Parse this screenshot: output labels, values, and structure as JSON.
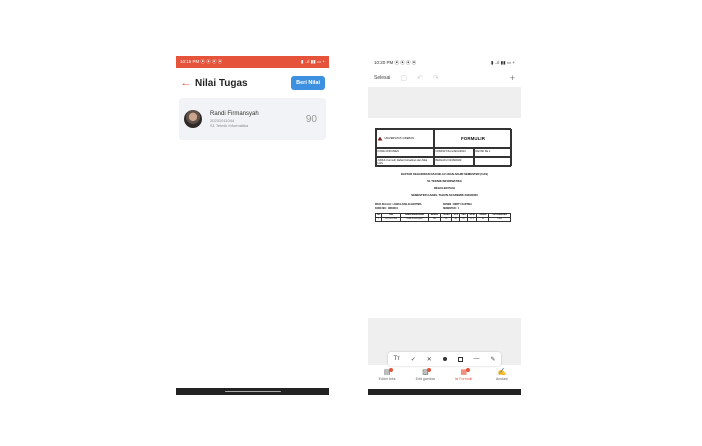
{
  "left_phone": {
    "status": {
      "time": "10:15 PM",
      "icons_left": "⦿ ⦿ ⦿ ⦿",
      "icons_right": "▮ ..ıl ▮▮ ▭ +"
    },
    "header": {
      "back_icon": "←",
      "title": "Nilai Tugas",
      "beri_nilai_label": "Beri Nilai"
    },
    "student": {
      "name": "Randi Firmansyah",
      "nim": "20231011044",
      "prodi": "S1 Teknik Informatika",
      "score": "90"
    }
  },
  "right_phone": {
    "status": {
      "time": "10:20 PM",
      "icons_left": "⦿ ⦿ ⦿ ⦿",
      "icons_right": "▮ ..ıl ▮▮ ▭ +"
    },
    "toolbar": {
      "done_label": "Selesai",
      "plus_icon": "+"
    },
    "document": {
      "logo_text": "UNIVERSITAS CIREBON",
      "formulir": "FORMULIR",
      "kode_label": "KODE DOKUMEN",
      "kode_value": "",
      "nomor_label": "NOMOR",
      "nomor_value": "FKom/AKA/2023",
      "revisi_label": "REVISI KE",
      "revisi_value": "1",
      "judul_label": "JUDUL",
      "judul_value": "Formulir Daftar Kehadiran dan Nilai UAS",
      "berlaku_label": "BERLAKU",
      "berlaku_value": "01/09/2023",
      "caption1": "DAFTAR KEHADIRAN DAN NILAI UJIAN AKHIR SEMESTER (UAS)",
      "caption2": "S1 TEKNIK INFORMATIKA",
      "caption3": "REGULER PAGI",
      "caption4": "SEMESTER GANJIL TAHUN AKADEMIK 2023/2023",
      "meta_matkul": "MATA KULIAH   : LOGIKA DAN ALGORITMA",
      "meta_dosen": "DOSEN : BERTY KARTIKA",
      "meta_kode": "KODE MK  : 1MK0001",
      "meta_semester": "SEMESTER : 1",
      "table_headers": [
        "NO",
        "NIM",
        "NAMA MAHASISWA",
        "ABSEN",
        "TUGAS",
        "UTS",
        "UAS",
        "NILAI",
        "GRADE",
        "KETERANGAN"
      ],
      "table_row": [
        "1",
        "20231011044",
        "Randi Firmansyah",
        "100",
        "90",
        "80",
        "85",
        "87.5",
        "A",
        "Lulus"
      ]
    },
    "draw_tools": {
      "text_tool": "Tт",
      "check_tool": "✓",
      "cross_tool": "✕",
      "line_tool": "—",
      "pen_tool": "✎"
    },
    "bottom_tabs": [
      {
        "label": "Editor teks",
        "icon": "▤"
      },
      {
        "label": "Edit gambar",
        "icon": "▨"
      },
      {
        "label": "Isi Formulir",
        "icon": "▦"
      },
      {
        "label": "Anotasi",
        "icon": "✍"
      }
    ]
  }
}
